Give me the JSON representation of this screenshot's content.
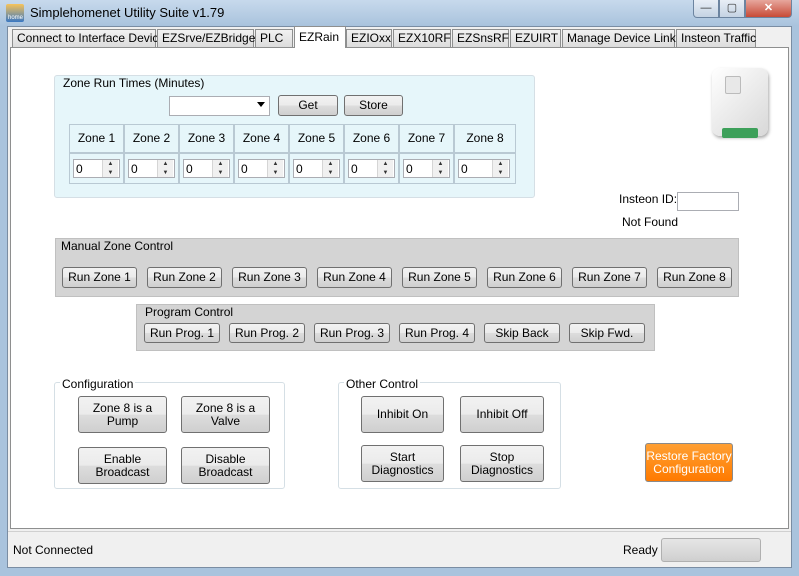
{
  "window": {
    "title": "Simplehomenet Utility Suite v1.79",
    "min_glyph": "—",
    "max_glyph": "▢",
    "close_glyph": "✕",
    "app_icon_text": "home"
  },
  "tabs": [
    {
      "label": "Connect to Interface Device",
      "active": false
    },
    {
      "label": "EZSrve/EZBridge",
      "active": false
    },
    {
      "label": "PLC",
      "active": false
    },
    {
      "label": "EZRain",
      "active": true
    },
    {
      "label": "EZIOxx",
      "active": false
    },
    {
      "label": "EZX10RF",
      "active": false
    },
    {
      "label": "EZSnsRF",
      "active": false
    },
    {
      "label": "EZUIRT",
      "active": false
    },
    {
      "label": "Manage Device Links",
      "active": false
    },
    {
      "label": "Insteon Traffic",
      "active": false
    }
  ],
  "zone_run_times": {
    "title": "Zone Run Times (Minutes)",
    "dropdown_value": "",
    "get_label": "Get",
    "store_label": "Store",
    "zones": [
      {
        "label": "Zone 1",
        "value": "0"
      },
      {
        "label": "Zone 2",
        "value": "0"
      },
      {
        "label": "Zone 3",
        "value": "0"
      },
      {
        "label": "Zone 4",
        "value": "0"
      },
      {
        "label": "Zone 5",
        "value": "0"
      },
      {
        "label": "Zone 6",
        "value": "0"
      },
      {
        "label": "Zone 7",
        "value": "0"
      },
      {
        "label": "Zone 8",
        "value": "0"
      }
    ]
  },
  "device": {
    "insteon_id_label": "Insteon ID:",
    "insteon_id_value": "",
    "status": "Not Found"
  },
  "manual_zone_control": {
    "title": "Manual Zone Control",
    "buttons": [
      "Run Zone 1",
      "Run Zone 2",
      "Run Zone 3",
      "Run Zone 4",
      "Run Zone 5",
      "Run Zone 6",
      "Run Zone 7",
      "Run Zone 8"
    ]
  },
  "program_control": {
    "title": "Program Control",
    "buttons": [
      "Run Prog. 1",
      "Run Prog. 2",
      "Run Prog. 3",
      "Run Prog. 4",
      "Skip Back",
      "Skip Fwd."
    ]
  },
  "configuration": {
    "title": "Configuration",
    "zone8_pump": "Zone 8 is a Pump",
    "zone8_valve": "Zone 8 is a Valve",
    "enable_broadcast": "Enable Broadcast",
    "disable_broadcast": "Disable Broadcast"
  },
  "other_control": {
    "title": "Other Control",
    "inhibit_on": "Inhibit On",
    "inhibit_off": "Inhibit Off",
    "start_diagnostics": "Start Diagnostics",
    "stop_diagnostics": "Stop Diagnostics"
  },
  "restore_factory": "Restore Factory Configuration",
  "statusbar": {
    "connection": "Not Connected",
    "state": "Ready"
  },
  "colors": {
    "accent_orange": "#ff8c00",
    "zone_panel_bg": "#e6f6fa",
    "control_panel_bg": "#d4d4d4"
  }
}
